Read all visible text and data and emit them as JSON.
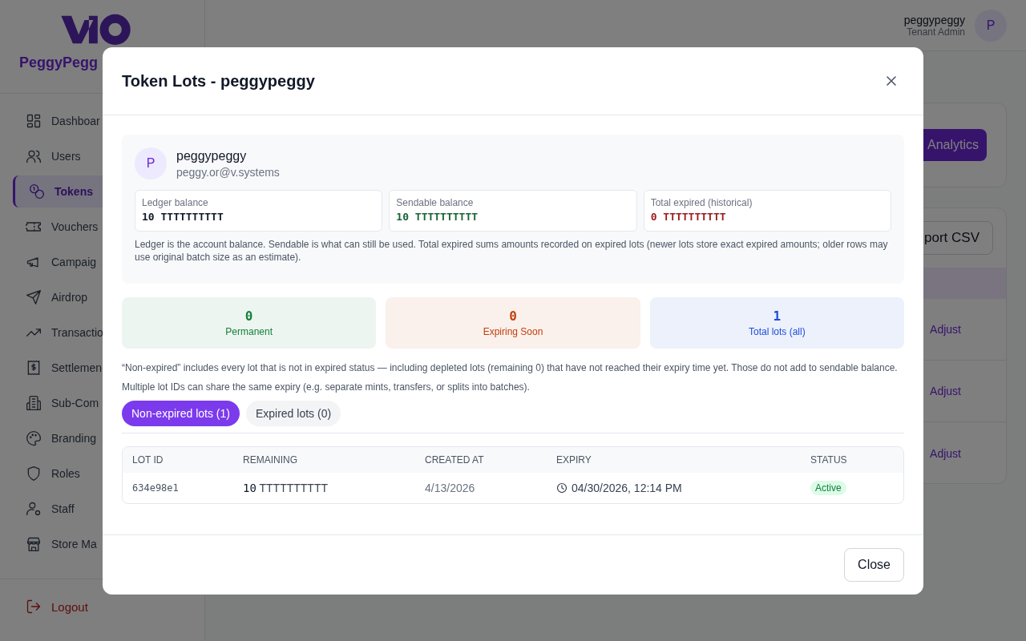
{
  "sidebar": {
    "brand": "PeggyPegg",
    "items": [
      {
        "label": "Dashboar",
        "selected": false
      },
      {
        "label": "Users",
        "selected": false
      },
      {
        "label": "Tokens",
        "selected": true
      },
      {
        "label": "Vouchers",
        "selected": false
      },
      {
        "label": "Campaig",
        "selected": false
      },
      {
        "label": "Airdrop",
        "selected": false
      },
      {
        "label": "Transactio",
        "selected": false
      },
      {
        "label": "Settlemen",
        "selected": false
      },
      {
        "label": "Sub-Com",
        "selected": false
      },
      {
        "label": "Branding",
        "selected": false
      },
      {
        "label": "Roles",
        "selected": false
      },
      {
        "label": "Staff",
        "selected": false
      },
      {
        "label": "Store Ma",
        "selected": false
      }
    ],
    "logout": "Logout"
  },
  "header": {
    "user_name": "peggypeggy",
    "role": "Tenant Admin",
    "avatar": "P"
  },
  "background": {
    "analytics_button": "Analytics",
    "export_button": "port CSV",
    "row_actions": [
      "Adjust",
      "Adjust",
      "Adjust"
    ]
  },
  "modal": {
    "title": "Token Lots - peggypeggy",
    "account": {
      "avatar": "P",
      "name": "peggypeggy",
      "email": "peggy.or@v.systems"
    },
    "balances": [
      {
        "label": "Ledger balance",
        "amount": "10 TTTTTTTTTT",
        "color": "#111827"
      },
      {
        "label": "Sendable balance",
        "amount": "10 TTTTTTTTTT",
        "color": "#166534"
      },
      {
        "label": "Total expired (historical)",
        "amount": "0 TTTTTTTTTT",
        "color": "#991b1b"
      }
    ],
    "balance_note": "Ledger is the account balance. Sendable is what can still be used. Total expired sums amounts recorded on expired lots (newer lots store exact expired amounts; older rows may use original batch size as an estimate).",
    "stats": [
      {
        "value": "0",
        "label": "Permanent",
        "color": "#15803d"
      },
      {
        "value": "0",
        "label": "Expiring Soon",
        "color": "#c2410c"
      },
      {
        "value": "1",
        "label": "Total lots (all)",
        "color": "#1d4ed8"
      }
    ],
    "notes": [
      "“Non-expired” includes every lot that is not in expired status — including depleted lots (remaining 0) that have not reached their expiry time yet. Those do not add to sendable balance.",
      "Multiple lot IDs can share the same expiry (e.g. separate mints, transfers, or splits into batches)."
    ],
    "tabs": [
      {
        "label": "Non-expired lots",
        "count": "(1)",
        "selected": true
      },
      {
        "label": "Expired lots",
        "count": "(0)",
        "selected": false
      }
    ],
    "table": {
      "columns": [
        "LOT ID",
        "REMAINING",
        "CREATED AT",
        "EXPIRY",
        "STATUS"
      ],
      "rows": [
        {
          "lot_id": "634e98e1",
          "remaining": "10",
          "unit": "TTTTTTTTTT",
          "created_at": "4/13/2026",
          "expiry": "04/30/2026, 12:14 PM",
          "status": "Active"
        }
      ]
    },
    "close_button": "Close"
  }
}
